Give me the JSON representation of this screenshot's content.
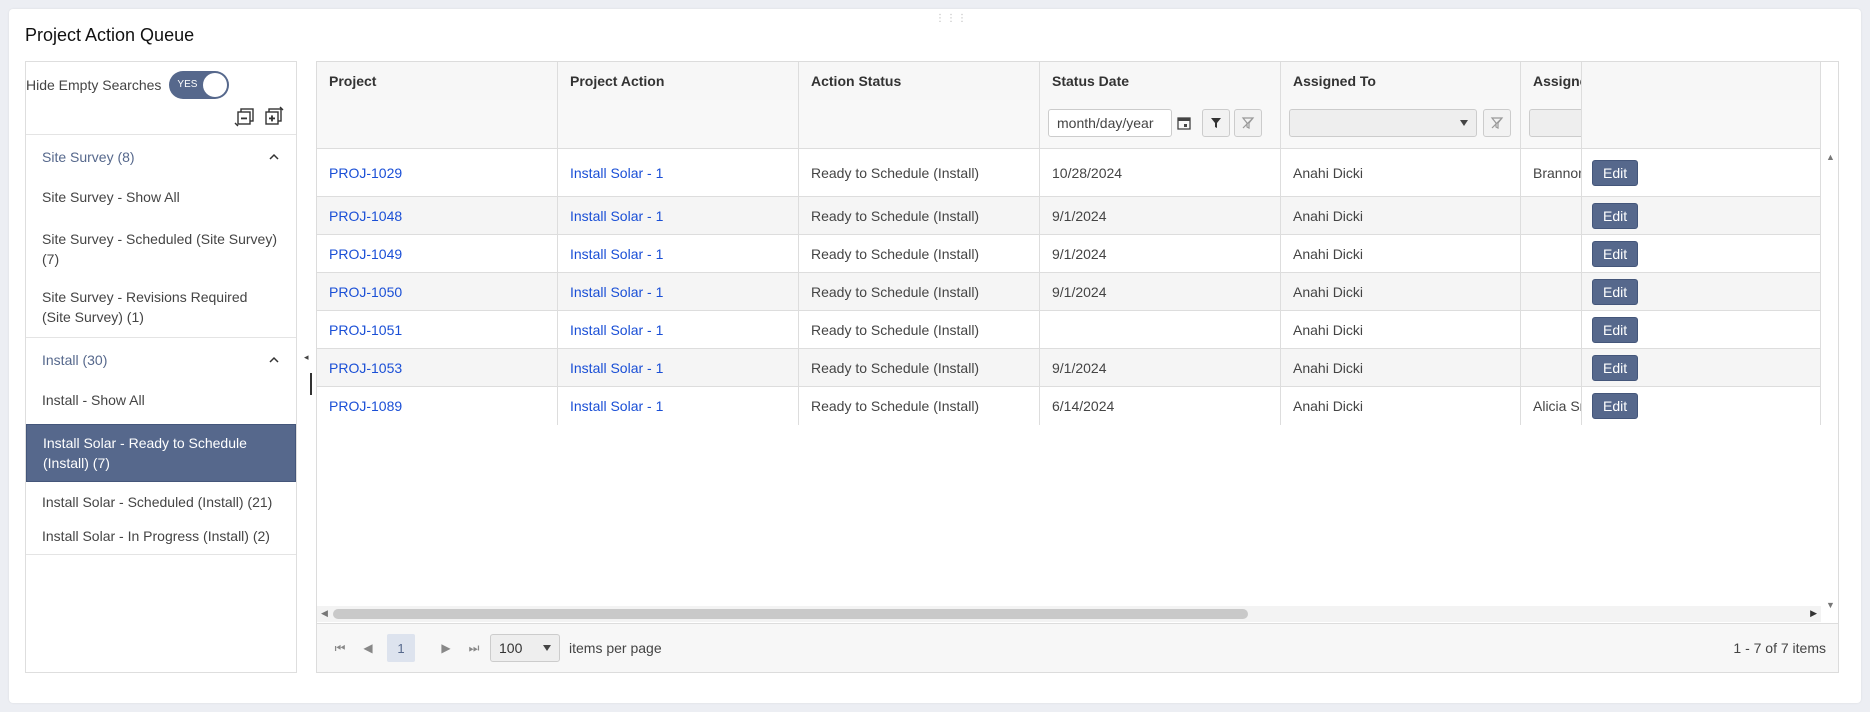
{
  "page": {
    "title": "Project Action Queue"
  },
  "left_panel": {
    "toggle_label": "Hide Empty Searches",
    "toggle_value": "YES",
    "groups": [
      {
        "title": "Site Survey (8)",
        "items": [
          {
            "label": "Site Survey - Show All"
          },
          {
            "label": "Site Survey - Scheduled (Site Survey) (7)"
          },
          {
            "label": "Site Survey - Revisions Required (Site Survey) (1)"
          }
        ]
      },
      {
        "title": "Install (30)",
        "items": [
          {
            "label": "Install - Show All"
          },
          {
            "label": "Install Solar - Ready to Schedule (Install) (7)"
          },
          {
            "label": "Install Solar - Scheduled (Install) (21)"
          },
          {
            "label": "Install Solar - In Progress (Install) (2)"
          }
        ]
      }
    ]
  },
  "grid": {
    "columns": [
      "Project",
      "Project Action",
      "Action Status",
      "Status Date",
      "Assigned To",
      "Assigne"
    ],
    "filters": {
      "date_placeholder": "month/day/year"
    },
    "rows": [
      {
        "project": "PROJ-1029",
        "action": "Install Solar - 1",
        "status": "Ready to Schedule (Install)",
        "date": "10/28/2024",
        "assigned": "Anahi Dicki",
        "assignee2": "Brannon",
        "edit": "Edit"
      },
      {
        "project": "PROJ-1048",
        "action": "Install Solar - 1",
        "status": "Ready to Schedule (Install)",
        "date": "9/1/2024",
        "assigned": "Anahi Dicki",
        "assignee2": "",
        "edit": "Edit"
      },
      {
        "project": "PROJ-1049",
        "action": "Install Solar - 1",
        "status": "Ready to Schedule (Install)",
        "date": "9/1/2024",
        "assigned": "Anahi Dicki",
        "assignee2": "",
        "edit": "Edit"
      },
      {
        "project": "PROJ-1050",
        "action": "Install Solar - 1",
        "status": "Ready to Schedule (Install)",
        "date": "9/1/2024",
        "assigned": "Anahi Dicki",
        "assignee2": "",
        "edit": "Edit"
      },
      {
        "project": "PROJ-1051",
        "action": "Install Solar - 1",
        "status": "Ready to Schedule (Install)",
        "date": "",
        "assigned": "Anahi Dicki",
        "assignee2": "",
        "edit": "Edit"
      },
      {
        "project": "PROJ-1053",
        "action": "Install Solar - 1",
        "status": "Ready to Schedule (Install)",
        "date": "9/1/2024",
        "assigned": "Anahi Dicki",
        "assignee2": "",
        "edit": "Edit"
      },
      {
        "project": "PROJ-1089",
        "action": "Install Solar - 1",
        "status": "Ready to Schedule (Install)",
        "date": "6/14/2024",
        "assigned": "Anahi Dicki",
        "assignee2": "Alicia Sr",
        "edit": "Edit"
      }
    ]
  },
  "pager": {
    "current_page": "1",
    "page_size": "100",
    "items_per_page_label": "items per page",
    "range_text": "1 - 7 of 7 items"
  },
  "icons": {
    "toggle": "toggle-switch",
    "collapse_all": "collapse-all-icon",
    "expand_all": "expand-all-icon",
    "group_toggle": "chevron-up-icon",
    "calendar": "calendar-icon",
    "filter": "filter-icon",
    "clear_filter": "clear-filter-icon"
  },
  "colors": {
    "accent": "#56688c",
    "link": "#1a4fd6"
  }
}
